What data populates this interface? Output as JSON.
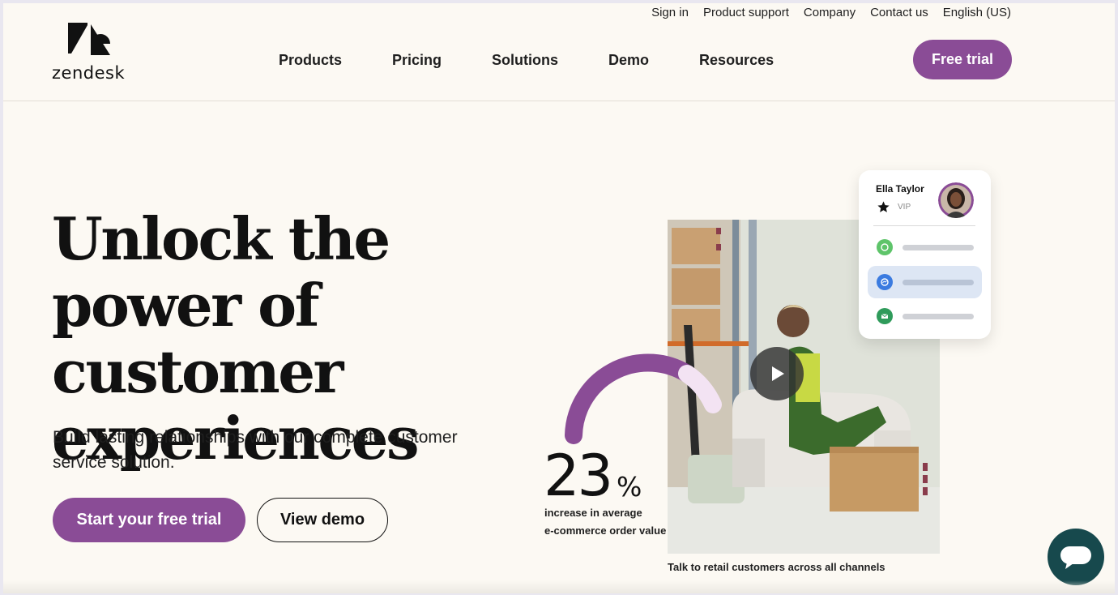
{
  "brand": {
    "name": "zendesk"
  },
  "utility_nav": [
    "Sign in",
    "Product support",
    "Company",
    "Contact us",
    "English (US)"
  ],
  "main_nav": [
    "Products",
    "Pricing",
    "Solutions",
    "Demo",
    "Resources"
  ],
  "header": {
    "cta_label": "Free trial"
  },
  "hero": {
    "title": "Unlock the power of customer experiences",
    "subtitle": "Build lasting relationships with our complete customer service solution.",
    "primary_cta": "Start your free trial",
    "secondary_cta": "View demo"
  },
  "stat": {
    "number": "23",
    "unit": "%",
    "caption_line1": "increase in average",
    "caption_line2": "e-commerce order value"
  },
  "media": {
    "caption": "Talk to retail customers across all channels"
  },
  "customer_card": {
    "name": "Ella Taylor",
    "badge": "VIP",
    "channels": [
      "whatsapp-icon",
      "messenger-icon",
      "email-icon"
    ]
  },
  "colors": {
    "brand_purple": "#8a4c96",
    "background": "#fcf9f3",
    "chat_widget": "#17494d",
    "arc_light": "#f3e3f3"
  }
}
